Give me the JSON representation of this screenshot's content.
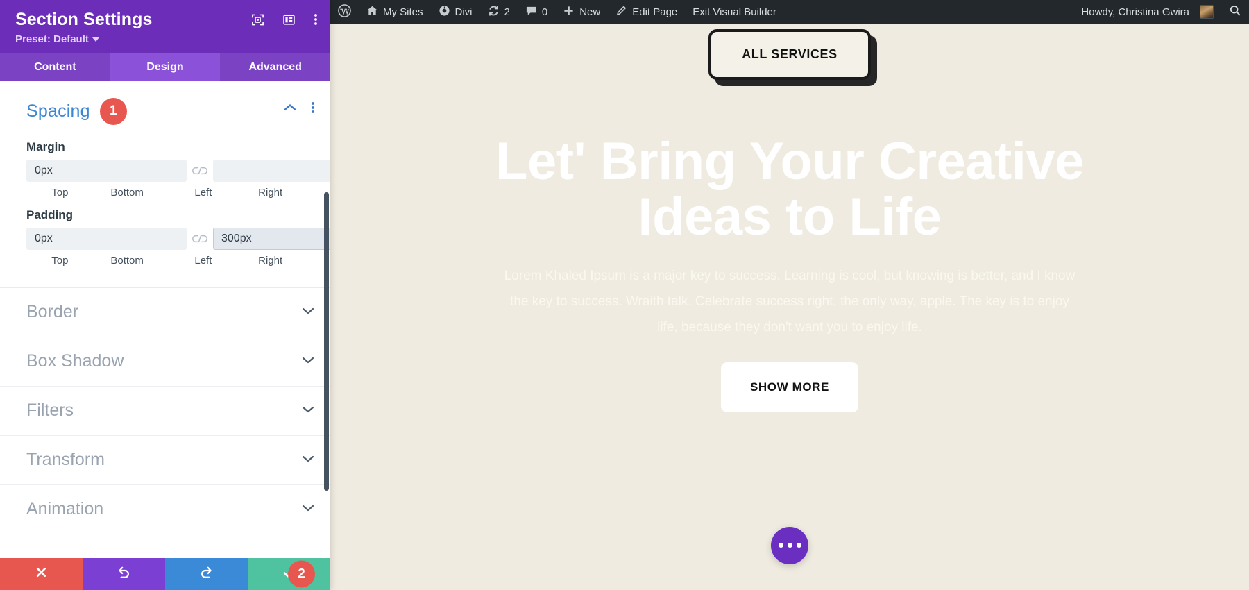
{
  "panel": {
    "title": "Section Settings",
    "preset_label": "Preset: Default",
    "icons": {
      "focus": "focus-target-icon",
      "layout": "panel-layout-icon",
      "more": "vertical-dots-icon"
    },
    "tabs": [
      {
        "label": "Content",
        "active": false
      },
      {
        "label": "Design",
        "active": true
      },
      {
        "label": "Advanced",
        "active": false
      }
    ],
    "spacing": {
      "title": "Spacing",
      "badge": "1",
      "collapse_icon": "chevron-up-icon",
      "more_icon": "vertical-dots-icon",
      "margin": {
        "label": "Margin",
        "top_value": "0px",
        "bottom_value": "",
        "left_value": "",
        "right_value": "",
        "labels": {
          "top": "Top",
          "bottom": "Bottom",
          "left": "Left",
          "right": "Right"
        },
        "link_icon": "broken-link-icon"
      },
      "padding": {
        "label": "Padding",
        "top_value": "0px",
        "bottom_value": "300px",
        "left_value": "",
        "right_value": "",
        "labels": {
          "top": "Top",
          "bottom": "Bottom",
          "left": "Left",
          "right": "Right"
        },
        "link_icon": "broken-link-icon"
      }
    },
    "sections": [
      {
        "label": "Border",
        "icon": "chevron-down-icon"
      },
      {
        "label": "Box Shadow",
        "icon": "chevron-down-icon"
      },
      {
        "label": "Filters",
        "icon": "chevron-down-icon"
      },
      {
        "label": "Transform",
        "icon": "chevron-down-icon"
      },
      {
        "label": "Animation",
        "icon": "chevron-down-icon"
      }
    ],
    "footer": {
      "cancel_icon": "close-x-icon",
      "undo_icon": "undo-arrow-icon",
      "redo_icon": "redo-arrow-icon",
      "save_icon": "checkmark-icon",
      "save_badge": "2"
    },
    "colors": {
      "header_purple": "#6c2eb9",
      "tab_purple": "#7b42c4",
      "tab_active_purple": "#8b51d8",
      "accent_blue": "#3b87d6",
      "badge_red": "#e8574f",
      "save_green": "#4fc2a0",
      "redo_blue": "#3b8ad8",
      "undo_purple": "#7b3fd4"
    }
  },
  "adminbar": {
    "items": [
      {
        "label": "",
        "icon": "wordpress-logo-icon"
      },
      {
        "label": "My Sites",
        "icon": "sites-house-icon"
      },
      {
        "label": "Divi",
        "icon": "divi-gauge-icon"
      },
      {
        "label": "2",
        "icon": "updates-refresh-icon"
      },
      {
        "label": "0",
        "icon": "comment-bubble-icon"
      },
      {
        "label": "New",
        "icon": "plus-icon"
      },
      {
        "label": "Edit Page",
        "icon": "pencil-icon"
      },
      {
        "label": "Exit Visual Builder",
        "icon": ""
      }
    ],
    "greeting": "Howdy, Christina Gwira",
    "avatar_icon": "user-avatar",
    "search_icon": "search-icon"
  },
  "canvas": {
    "background_color": "#efebe0",
    "all_services_label": "ALL SERVICES",
    "headline": "Let' Bring Your Creative Ideas to Life",
    "paragraph": "Lorem Khaled Ipsum is a major key to success. Learning is cool, but knowing is better, and I know the key to success. Wraith talk. Celebrate success right, the only way, apple. The key is to enjoy life, because they don't want you to enjoy life.",
    "show_more_label": "SHOW MORE",
    "fab_icon": "three-dots-icon"
  }
}
